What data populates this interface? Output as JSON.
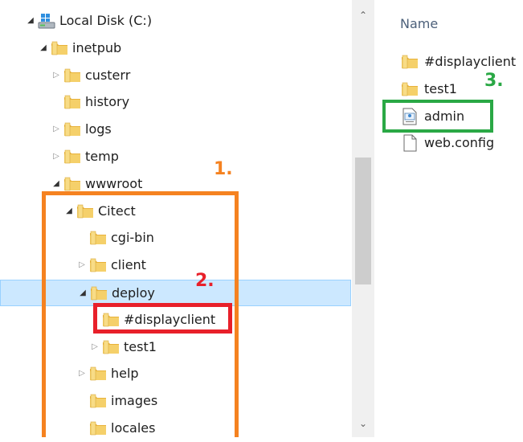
{
  "tree": [
    {
      "label": "Local Disk (C:)",
      "state": "expanded",
      "icon": "drive-icon"
    },
    {
      "label": "inetpub",
      "state": "expanded",
      "icon": "folder-icon"
    },
    {
      "label": "custerr",
      "state": "collapsed",
      "icon": "folder-icon"
    },
    {
      "label": "history",
      "state": "none",
      "icon": "folder-icon"
    },
    {
      "label": "logs",
      "state": "collapsed",
      "icon": "folder-icon"
    },
    {
      "label": "temp",
      "state": "collapsed",
      "icon": "folder-icon"
    },
    {
      "label": "wwwroot",
      "state": "expanded",
      "icon": "folder-icon"
    },
    {
      "label": "Citect",
      "state": "expanded",
      "icon": "folder-icon"
    },
    {
      "label": "cgi-bin",
      "state": "none",
      "icon": "folder-icon"
    },
    {
      "label": "client",
      "state": "collapsed",
      "icon": "folder-icon"
    },
    {
      "label": "deploy",
      "state": "expanded",
      "icon": "folder-icon",
      "selected": true
    },
    {
      "label": "#displayclient",
      "state": "none",
      "icon": "folder-icon"
    },
    {
      "label": "test1",
      "state": "collapsed",
      "icon": "folder-icon"
    },
    {
      "label": "help",
      "state": "collapsed",
      "icon": "folder-icon"
    },
    {
      "label": "images",
      "state": "none",
      "icon": "folder-icon"
    },
    {
      "label": "locales",
      "state": "none",
      "icon": "folder-icon"
    }
  ],
  "file_list": {
    "column_header": "Name",
    "items": [
      {
        "label": "#displayclient",
        "icon": "folder-icon"
      },
      {
        "label": "test1",
        "icon": "folder-icon"
      },
      {
        "label": "admin",
        "icon": "application-file-icon"
      },
      {
        "label": "web.config",
        "icon": "document-icon"
      }
    ]
  },
  "annotations": {
    "step1": "1.",
    "step2": "2.",
    "step3": "3."
  },
  "colors": {
    "selection": "#cce8ff",
    "annotation_orange": "#f58220",
    "annotation_red": "#e8202a",
    "annotation_green": "#2aa845",
    "folder": "#f5c84c"
  }
}
